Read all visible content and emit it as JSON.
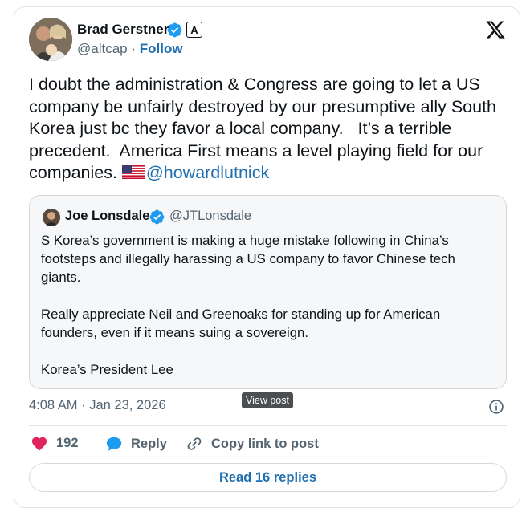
{
  "author": {
    "name": "Brad Gerstner",
    "handle": "@altcap",
    "separator": "·",
    "follow_label": "Follow",
    "badge_letter": "A"
  },
  "post": {
    "text": "I doubt the administration & Congress are going to let a US company be unfairly destroyed by our presumptive ally South Korea just bc they favor a local company.   It’s a terrible precedent.  America First means a level playing field for our companies. ",
    "mention": "@howardlutnick"
  },
  "quoted": {
    "name": "Joe Lonsdale",
    "handle": "@JTLonsdale",
    "text": "S Korea’s government is making a huge mistake following in China’s footsteps and illegally harassing a US company to favor Chinese tech giants.\n\nReally appreciate Neil and Greenoaks for standing up for American founders, even if it means suing a sovereign.\n\nKorea’s President Lee"
  },
  "meta": {
    "timestamp": "4:08 AM · Jan 23, 2026",
    "tooltip": "View post"
  },
  "actions": {
    "like_count": "192",
    "reply_label": "Reply",
    "copy_label": "Copy link to post",
    "read_replies_label": "Read 16 replies"
  },
  "colors": {
    "link": "#1d6fb0",
    "like": "#e0245e",
    "verified": "#1d9bf0",
    "muted": "#536471"
  },
  "icons": [
    "verified-badge-icon",
    "affiliate-badge-icon",
    "x-logo-icon",
    "info-icon",
    "heart-icon",
    "reply-bubble-icon",
    "link-icon",
    "us-flag-icon"
  ]
}
